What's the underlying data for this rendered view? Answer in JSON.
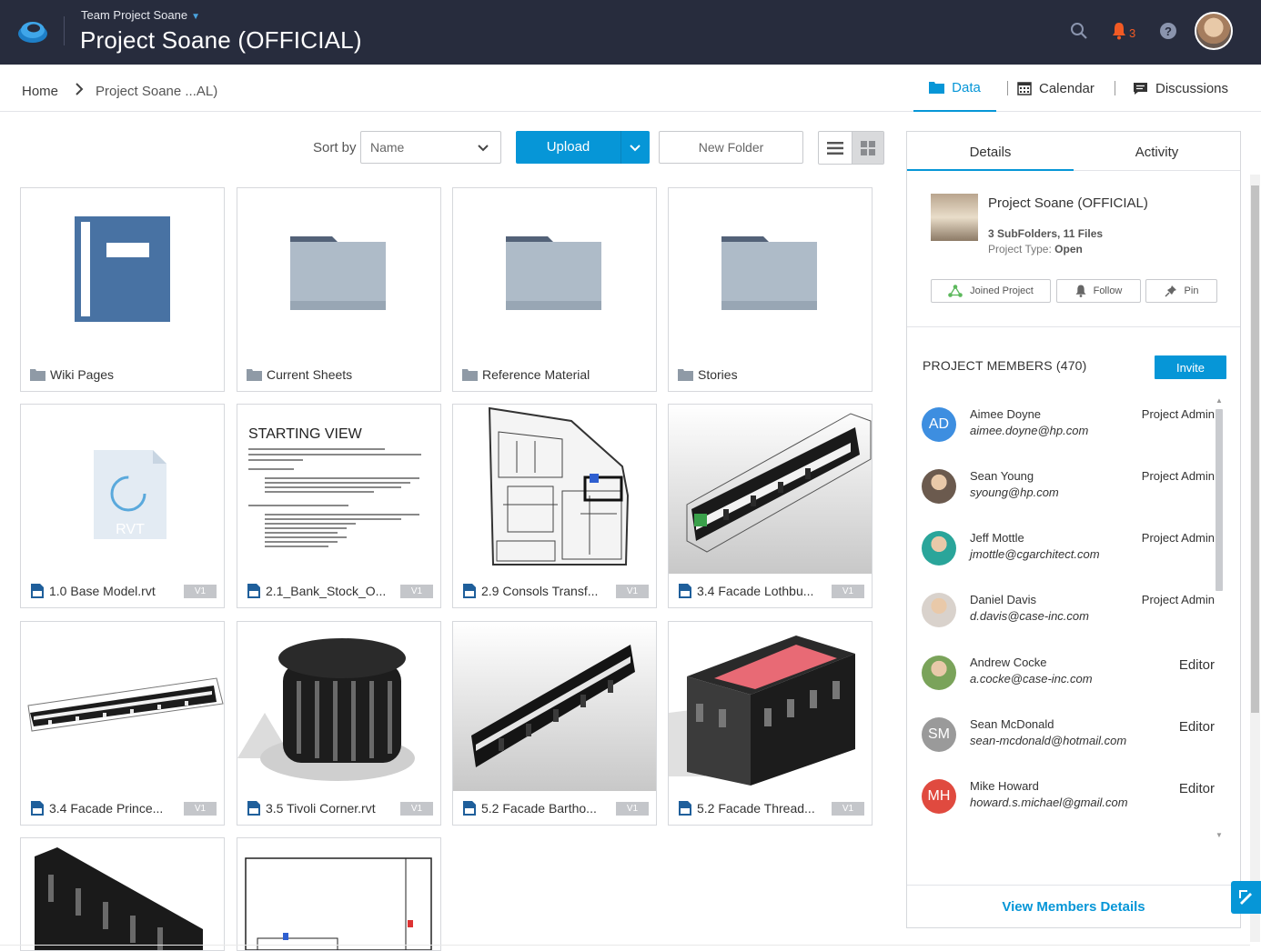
{
  "header": {
    "team": "Team Project Soane",
    "project_title": "Project Soane (OFFICIAL)",
    "notification_count": "3",
    "icons": [
      "search-icon",
      "bell-icon",
      "help-icon"
    ]
  },
  "breadcrumb": {
    "home": "Home",
    "current": "Project Soane ...AL)"
  },
  "nav_tabs": {
    "data": "Data",
    "calendar": "Calendar",
    "discussions": "Discussions"
  },
  "toolbar": {
    "sort_label": "Sort by",
    "sort_value": "Name",
    "upload_label": "Upload",
    "new_folder_label": "New Folder"
  },
  "items": [
    {
      "name": "Wiki Pages",
      "kind": "folder"
    },
    {
      "name": "Current Sheets",
      "kind": "folder"
    },
    {
      "name": "Reference Material",
      "kind": "folder"
    },
    {
      "name": "Stories",
      "kind": "folder"
    },
    {
      "name": "1.0 Base Model.rvt",
      "version": "V1",
      "kind": "file"
    },
    {
      "name": "2.1_Bank_Stock_O...",
      "version": "V1",
      "kind": "file"
    },
    {
      "name": "2.9 Consols Transf...",
      "version": "V1",
      "kind": "file"
    },
    {
      "name": "3.4 Facade Lothbu...",
      "version": "V1",
      "kind": "file"
    },
    {
      "name": "3.4 Facade Prince...",
      "version": "V1",
      "kind": "file"
    },
    {
      "name": "3.5 Tivoli Corner.rvt",
      "version": "V1",
      "kind": "file"
    },
    {
      "name": "5.2 Facade Bartho...",
      "version": "V1",
      "kind": "file"
    },
    {
      "name": "5.2 Facade Thread...",
      "version": "V1",
      "kind": "file"
    }
  ],
  "thumb_text": {
    "rvt": "RVT",
    "starting_view": "STARTING VIEW"
  },
  "panel": {
    "tabs": {
      "details": "Details",
      "activity": "Activity"
    },
    "project_name": "Project Soane (OFFICIAL)",
    "counts": "3 SubFolders, 11 Files",
    "type_label": "Project Type:",
    "type_value": "Open",
    "buttons": {
      "joined": "Joined Project",
      "follow": "Follow",
      "pin": "Pin"
    },
    "members_title": "PROJECT MEMBERS (470)",
    "invite": "Invite",
    "members": [
      {
        "initials": "AD",
        "name": "Aimee Doyne",
        "email": "aimee.doyne@hp.com",
        "role": "Project Admin",
        "color": "#3d8ee0"
      },
      {
        "initials": "",
        "name": "Sean Young",
        "email": "syoung@hp.com",
        "role": "Project Admin",
        "color": "#6b5a4e"
      },
      {
        "initials": "",
        "name": "Jeff Mottle",
        "email": "jmottle@cgarchitect.com",
        "role": "Project Admin",
        "color": "#2aa59a"
      },
      {
        "initials": "",
        "name": "Daniel Davis",
        "email": "d.davis@case-inc.com",
        "role": "Project Admin",
        "color": "#d9d2cc"
      },
      {
        "initials": "",
        "name": "Andrew Cocke",
        "email": "a.cocke@case-inc.com",
        "role": "Editor",
        "color": "#7aa35a"
      },
      {
        "initials": "SM",
        "name": "Sean McDonald",
        "email": "sean-mcdonald@hotmail.com",
        "role": "Editor",
        "color": "#9a9a9a"
      },
      {
        "initials": "MH",
        "name": "Mike Howard",
        "email": "howard.s.michael@gmail.com",
        "role": "Editor",
        "color": "#e04a3f"
      }
    ],
    "view_members": "View Members Details"
  },
  "colors": {
    "accent": "#0696d7",
    "header_bg": "#272c3d",
    "notification": "#f15a24",
    "folder": "#aebbc8",
    "folder_tab": "#536278"
  }
}
